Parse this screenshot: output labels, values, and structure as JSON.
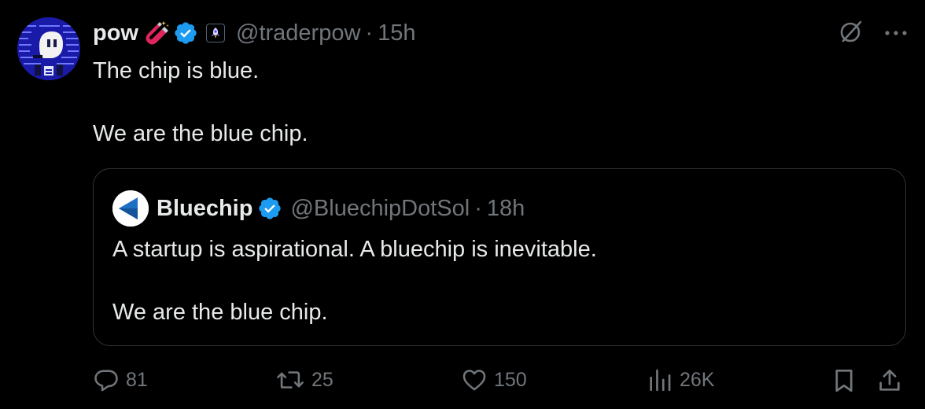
{
  "post": {
    "author_name": "pow",
    "name_emoji": "magnet-sparkle-emoji",
    "handle": "@traderpow",
    "separator": "·",
    "time": "15h",
    "text_line1": "The chip is blue.",
    "text_line2": "We are the blue chip."
  },
  "quoted": {
    "author_name": "Bluechip",
    "handle": "@BluechipDotSol",
    "separator": "·",
    "time": "18h",
    "text_line1": "A startup is aspirational. A bluechip is inevitable.",
    "text_line2": "We are the blue chip."
  },
  "actions": {
    "replies": "81",
    "reposts": "25",
    "likes": "150",
    "views": "26K"
  },
  "icons": {
    "verified": "verified-badge-icon",
    "affiliate": "affiliate-rocket-icon",
    "grok": "grok-icon",
    "more": "more-icon",
    "reply": "reply-icon",
    "repost": "repost-icon",
    "like": "like-icon",
    "views": "views-icon",
    "bookmark": "bookmark-icon",
    "share": "share-icon"
  },
  "colors": {
    "background": "#000000",
    "text": "#e7e9ea",
    "muted": "#71767b",
    "border": "#2f3336",
    "verified_blue": "#1d9bf0",
    "avatar_blue": "#1a1aa8"
  }
}
